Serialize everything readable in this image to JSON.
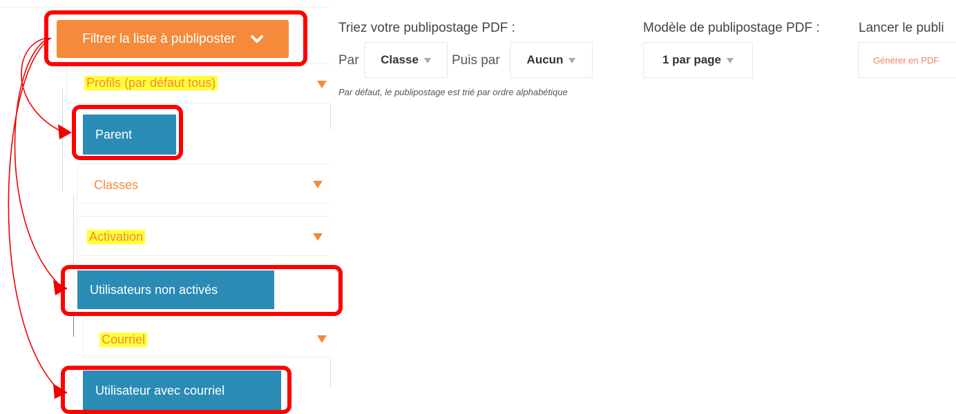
{
  "filter_panel": {
    "toggle_label": "Filtrer la liste à publiposter",
    "sections": [
      {
        "label": "Profils (par défaut tous)",
        "highlighted": true,
        "option": "Parent"
      },
      {
        "label": "Classes",
        "highlighted": false,
        "option": null
      },
      {
        "label": "Activation",
        "highlighted": true,
        "option": "Utilisateurs non activés"
      },
      {
        "label": "Courriel",
        "highlighted": true,
        "option": "Utilisateur avec courriel"
      }
    ]
  },
  "sort": {
    "title": "Triez votre publipostage PDF :",
    "by_label": "Par",
    "by_value": "Classe",
    "then_label": "Puis par",
    "then_value": "Aucun",
    "hint": "Par défaut, le publipostage est trié par ordre alphabétique"
  },
  "template": {
    "title": "Modèle de publipostage PDF :",
    "value": "1 par page"
  },
  "launch": {
    "title": "Lancer le publi",
    "button_label": "Générer en PDF"
  },
  "colors": {
    "accent_orange": "#f58a3a",
    "option_blue": "#2a8bb5",
    "annotation_red": "#ff0000",
    "text_highlight": "#ffff3a"
  }
}
